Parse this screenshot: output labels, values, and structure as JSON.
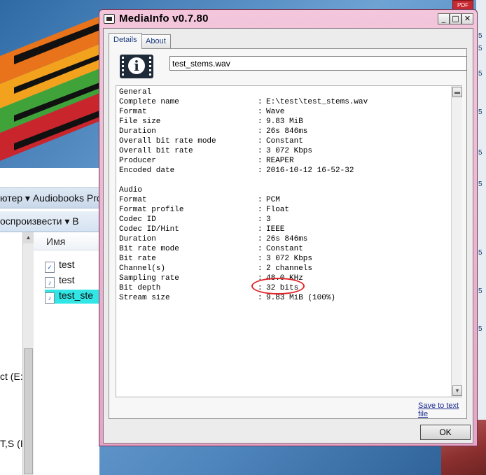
{
  "window": {
    "title": "MediaInfo v0.7.80",
    "controls": {
      "minimize": "_",
      "maximize": "□",
      "close": "✕"
    }
  },
  "tabs": [
    {
      "label": "Details",
      "active": true
    },
    {
      "label": "About",
      "active": false
    }
  ],
  "file_field": {
    "value": "test_stems.wav"
  },
  "general": {
    "heading": "General",
    "rows": [
      {
        "key": "Complete name",
        "value": "E:\\test\\test_stems.wav"
      },
      {
        "key": "Format",
        "value": "Wave"
      },
      {
        "key": "File size",
        "value": "9.83 MiB"
      },
      {
        "key": "Duration",
        "value": "26s 846ms"
      },
      {
        "key": "Overall bit rate mode",
        "value": "Constant"
      },
      {
        "key": "Overall bit rate",
        "value": "3 072 Kbps"
      },
      {
        "key": "Producer",
        "value": "REAPER"
      },
      {
        "key": "Encoded date",
        "value": "2016-10-12 16-52-32"
      }
    ]
  },
  "audio": {
    "heading": "Audio",
    "rows": [
      {
        "key": "Format",
        "value": "PCM"
      },
      {
        "key": "Format profile",
        "value": "Float"
      },
      {
        "key": "Codec ID",
        "value": "3"
      },
      {
        "key": "Codec ID/Hint",
        "value": "IEEE"
      },
      {
        "key": "Duration",
        "value": "26s 846ms"
      },
      {
        "key": "Bit rate mode",
        "value": "Constant"
      },
      {
        "key": "Bit rate",
        "value": "3 072 Kbps"
      },
      {
        "key": "Channel(s)",
        "value": "2 channels"
      },
      {
        "key": "Sampling rate",
        "value": "48.0 KHz"
      },
      {
        "key": "Bit depth",
        "value": "32 bits"
      },
      {
        "key": "Stream size",
        "value": "9.83 MiB (100%)"
      }
    ]
  },
  "separator": ":",
  "save_link": "Save to text file",
  "ok_button": "OK",
  "explorer": {
    "address_text": "ютер ▾ Audiobooks Pro",
    "toolbar_text": "оспроизвести ▾   B",
    "column_header": "Имя",
    "nav_items": [
      "ct (E:",
      "T,S (I"
    ],
    "files": [
      {
        "name": "test",
        "selected": false
      },
      {
        "name": "test",
        "selected": false
      },
      {
        "name": "test_ste",
        "selected": true
      }
    ]
  },
  "desktop_edge": {
    "pdf_badge": "PDF",
    "numbers": [
      "5",
      "5",
      "5",
      "5",
      "5",
      "5",
      "5",
      "5",
      "5"
    ]
  },
  "colors": {
    "title_gradient_top": "#f3c6dc",
    "highlight_circle": "#e0262a",
    "selection": "#33e6e6"
  }
}
